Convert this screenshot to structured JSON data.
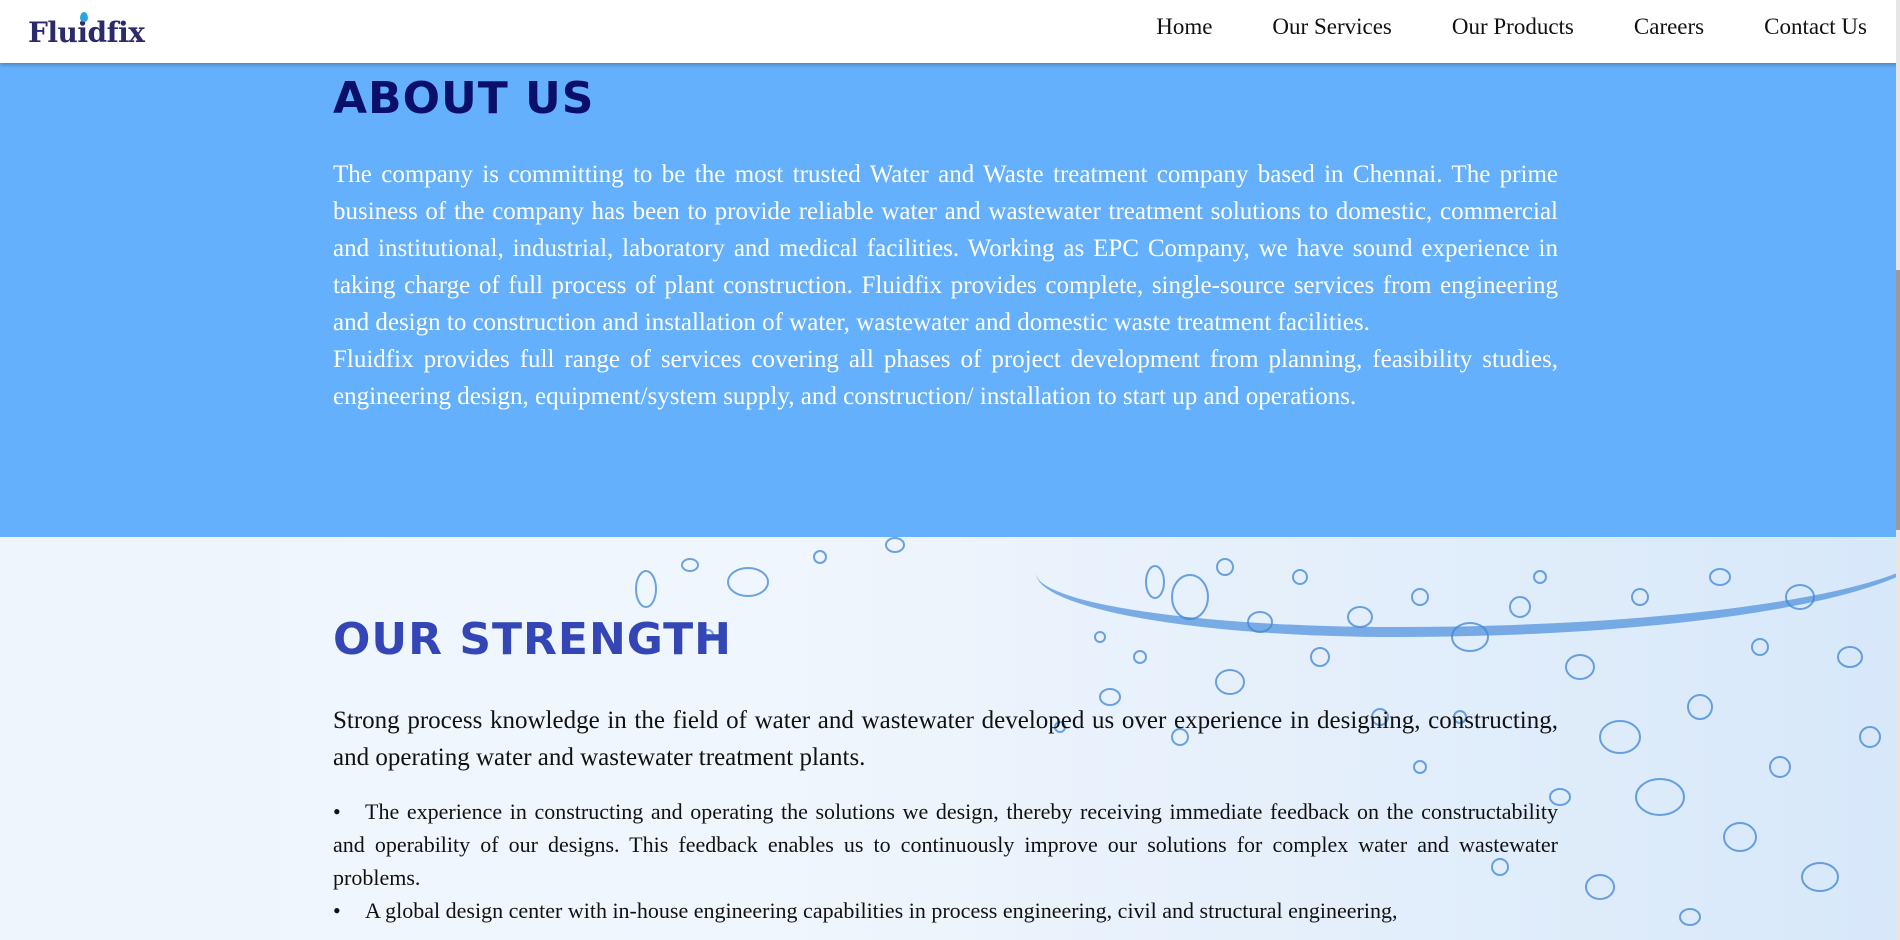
{
  "header": {
    "logo_text": "Fluidfix",
    "nav": [
      "Home",
      "Our Services",
      "Our Products",
      "Careers",
      "Contact Us"
    ]
  },
  "about": {
    "title": "ABOUT US",
    "paragraph1": "The company is committing to be the most trusted Water and Waste treatment company based in Chennai. The prime business of the company has been to provide reliable water and wastewater treatment solutions to domestic, commercial and institutional, industrial, laboratory and medical facilities. Working as EPC Company, we have sound experience in taking charge of full process of plant construction. Fluidfix provides complete, single-source services from engineering and design to construction and installation of water, wastewater and domestic waste treatment facilities.",
    "paragraph2": "Fluidfix provides full range of services covering all phases of project development from planning, feasibility studies, engineering design, equipment/system supply, and construction/ installation to start up and operations."
  },
  "strength": {
    "title": "OUR STRENGTH",
    "intro": "Strong process knowledge in the field of water and wastewater developed us over experience in designing, constructing, and operating water and wastewater treatment plants.",
    "bullets": [
      "The experience in constructing and operating the solutions we design, thereby receiving immediate feedback on the constructability and operability of our designs. This feedback enables us to continuously improve our solutions for complex water and wastewater problems.",
      "A global design center with in-house engineering capabilities in process engineering, civil and structural engineering,"
    ]
  },
  "colors": {
    "about_bg": "#65b0fc",
    "about_title": "#0a1069",
    "strength_title": "#3446b5",
    "logo": "#2b2a6b"
  }
}
